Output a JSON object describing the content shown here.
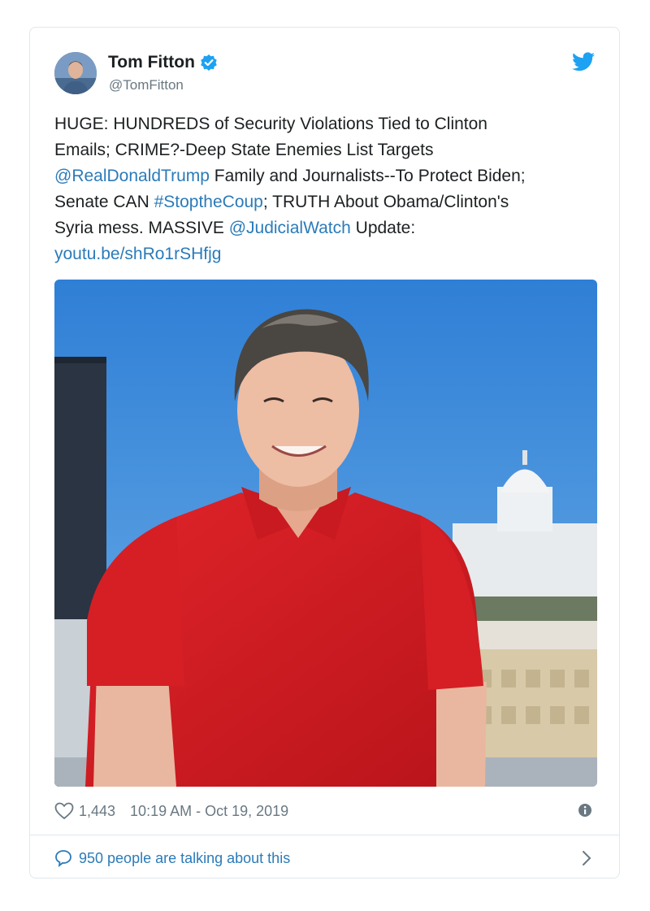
{
  "author": {
    "name": "Tom Fitton",
    "handle": "@TomFitton",
    "verified": true
  },
  "tweet": {
    "segments_line1": [
      {
        "text": "HUGE: HUNDREDS of Security Violations Tied to Clinton",
        "link": false
      }
    ],
    "segments_line2": [
      {
        "text": "Emails; CRIME?-Deep State Enemies List Targets",
        "link": false
      }
    ],
    "line3": {
      "mention": "@RealDonaldTrump",
      "rest": " Family and Journalists--To Protect Biden;"
    },
    "line4": {
      "pre": "Senate CAN ",
      "hashtag": "#StoptheCoup",
      "rest": "; TRUTH About Obama/Clinton's"
    },
    "line5": {
      "pre": "Syria mess. MASSIVE ",
      "mention": "@JudicialWatch",
      "rest": " Update:"
    },
    "url": "youtu.be/shRo1rSHfjg"
  },
  "footer": {
    "likes": "1,443",
    "timestamp": "10:19 AM - Oct 19, 2019"
  },
  "conversation": {
    "label": "950 people are talking about this"
  },
  "icons": {
    "verified": "verified-badge-icon",
    "brand": "twitter-bird-icon",
    "like": "heart-icon",
    "info": "info-icon",
    "reply": "speech-bubble-icon",
    "more": "chevron-right-icon"
  },
  "colors": {
    "link": "#2b7bb9",
    "twitter_blue": "#1da1f2",
    "muted": "#697882",
    "text": "#1c2022"
  }
}
